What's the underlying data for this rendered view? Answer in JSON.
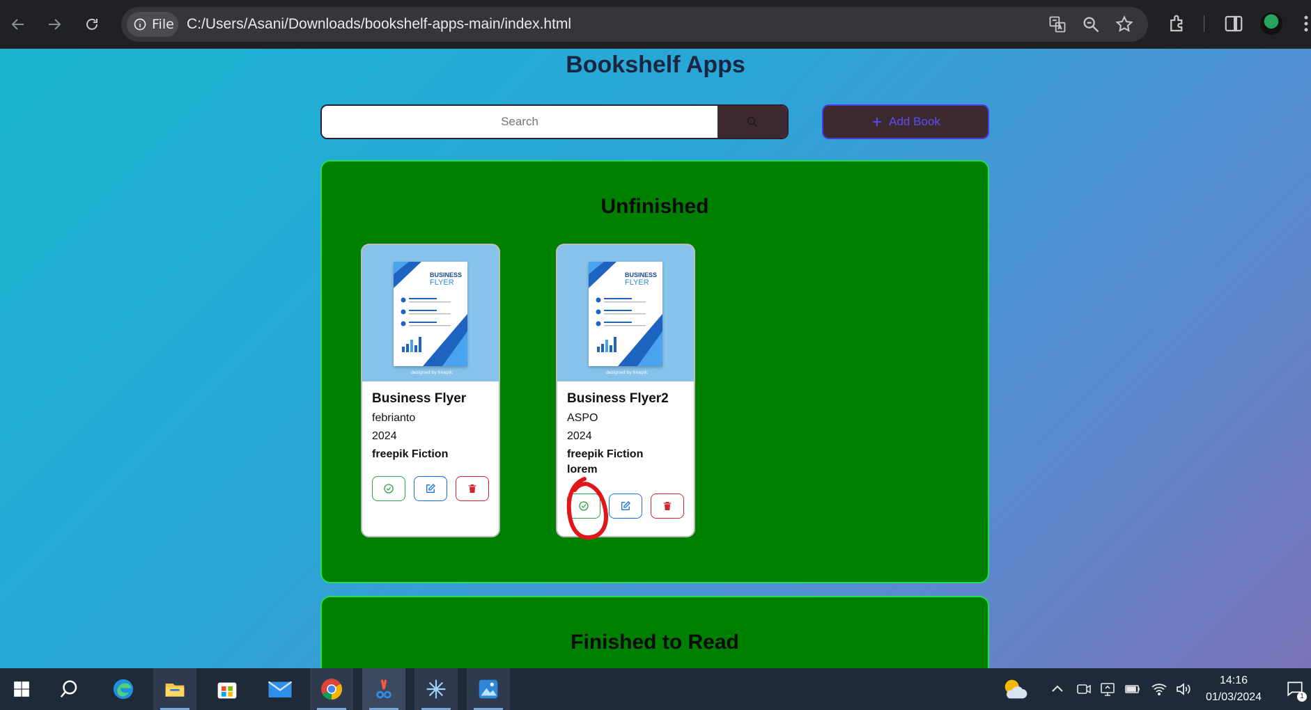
{
  "browser": {
    "site_chip": "File",
    "url": "C:/Users/Asani/Downloads/bookshelf-apps-main/index.html"
  },
  "app": {
    "title": "Bookshelf Apps",
    "search_placeholder": "Search",
    "add_book_label": "Add Book"
  },
  "shelves": {
    "unfinished": {
      "title": "Unfinished",
      "books": [
        {
          "title": "Business Flyer",
          "author": "febrianto",
          "year": "2024",
          "publisher_genre": "freepik Fiction",
          "extra": ""
        },
        {
          "title": "Business Flyer2",
          "author": "ASPO",
          "year": "2024",
          "publisher_genre": "freepik Fiction",
          "extra": "lorem"
        }
      ]
    },
    "finished": {
      "title": "Finished to Read"
    }
  },
  "cover": {
    "flyer_title": "BUSINESS",
    "flyer_subtitle": "FLYER",
    "credit": "designed by freepik"
  },
  "taskbar": {
    "time": "14:16",
    "date": "01/03/2024",
    "notification_count": "1"
  },
  "colors": {
    "shelf_bg": "#008000",
    "shelf_border": "#22dd55",
    "done": "#2ea043",
    "edit": "#1a6fe0",
    "delete": "#d1242f",
    "annotation": "#e0161b"
  }
}
